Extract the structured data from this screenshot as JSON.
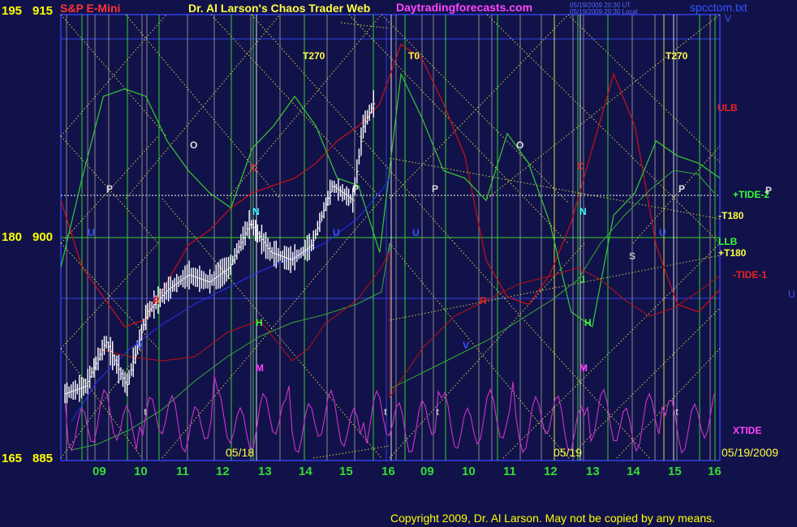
{
  "header": {
    "left_label": "S&P E-Mini",
    "center_title": "Dr. Al Larson's Chaos Trader Web",
    "site": "Daytradingforecasts.com",
    "time_ut": "05/19/2009 20:30 UT",
    "time_local": "05/19/2009 20:30 Local",
    "file": "spcctom.txt"
  },
  "y_axis": {
    "ticks": [
      {
        "left": "195",
        "right": "915",
        "price": 915
      },
      {
        "left": "180",
        "right": "900",
        "price": 900
      },
      {
        "left": "165",
        "right": "885",
        "price": 885
      }
    ]
  },
  "x_axis": {
    "hour_labels": [
      "09",
      "10",
      "11",
      "12",
      "13",
      "14",
      "15",
      "16",
      "09",
      "10",
      "11",
      "12",
      "13",
      "14",
      "15",
      "16"
    ],
    "date_labels": [
      "05/18",
      "05/19",
      "05/19/2009"
    ]
  },
  "footer": {
    "copyright": "Copyright 2009, Dr. Al Larson. May not be copied by any means."
  },
  "right_labels": {
    "v": "V",
    "ulb": "ULB",
    "tide2": "+TIDE-2",
    "p": "P",
    "t180m": "-T180",
    "llb": "LLB",
    "t180p": "+T180",
    "tide1": "-TIDE-1",
    "u": "U",
    "xtide": "XTIDE"
  },
  "markers": {
    "t270a": "T270",
    "t0": "T0",
    "t270b": "T270",
    "p1": "P",
    "p2": "P",
    "p3": "P",
    "p4": "P",
    "o1": "O",
    "o2": "O",
    "c1": "C",
    "c2": "C",
    "n1": "N",
    "n2": "N",
    "h1": "H",
    "h2": "H",
    "m1": "M",
    "m2": "M",
    "r1": "R",
    "r2": "R",
    "s1": "S",
    "u1": "U",
    "u2": "U",
    "u3": "U",
    "u4": "U",
    "v1": "V",
    "v2": "V",
    "t1": "t",
    "t2": "t",
    "t3": "t",
    "t4": "t",
    "j1": "J"
  },
  "colors": {
    "background": "#12124a",
    "price_bars": "#ffffff",
    "ulb_line": "#cc1111",
    "llb_line": "#33cc33",
    "xtide": "#cc33cc",
    "forecast_yellow": "#ffff44",
    "grid_blue": "#3344ee",
    "axis_yellow": "#ffff00"
  },
  "chart_data": {
    "type": "line",
    "title": "S&P E-Mini",
    "ylim": [
      885,
      915
    ],
    "x_days": [
      "05/18",
      "05/19"
    ],
    "series": [
      {
        "name": "price",
        "x": [
          "05/18 08:30",
          "05/18 09:00",
          "05/18 09:30",
          "05/18 10:00",
          "05/18 10:30",
          "05/18 11:00",
          "05/18 11:30",
          "05/18 12:00",
          "05/18 12:30",
          "05/18 13:00",
          "05/18 13:30",
          "05/18 14:00",
          "05/18 14:30",
          "05/18 15:00",
          "05/18 15:30",
          "05/18 15:45",
          "05/18 16:00"
        ],
        "values": [
          889.5,
          890.0,
          893.0,
          890.0,
          895.0,
          896.5,
          897.5,
          897.0,
          898.0,
          901.0,
          899.0,
          898.5,
          899.5,
          903.5,
          902.5,
          907.5,
          909.0
        ]
      },
      {
        "name": "ULB",
        "values": [
          902.5,
          898.0,
          896.0,
          894.0,
          894.5,
          897.0,
          899.5,
          900.5,
          902.0,
          903.0,
          903.5,
          904.0,
          905.0,
          906.5,
          907.5,
          909.0,
          913.0,
          912.0,
          909.0,
          905.5,
          898.5,
          896.0,
          895.5,
          897.5,
          901.0,
          906.0,
          911.0,
          907.5,
          899.5,
          895.5,
          895.0,
          896.5
        ]
      },
      {
        "name": "LLB",
        "values": [
          898.0,
          904.0,
          909.5,
          910.0,
          909.5,
          906.5,
          904.5,
          903.0,
          902.0,
          906.0,
          907.5,
          909.5,
          907.5,
          904.0,
          903.5,
          899.0,
          911.0,
          908.0,
          904.5,
          904.0,
          902.5,
          907.0,
          905.0,
          901.0,
          895.0,
          894.0,
          901.5,
          903.0,
          906.5,
          905.5,
          905.0,
          904.0
        ]
      }
    ]
  }
}
